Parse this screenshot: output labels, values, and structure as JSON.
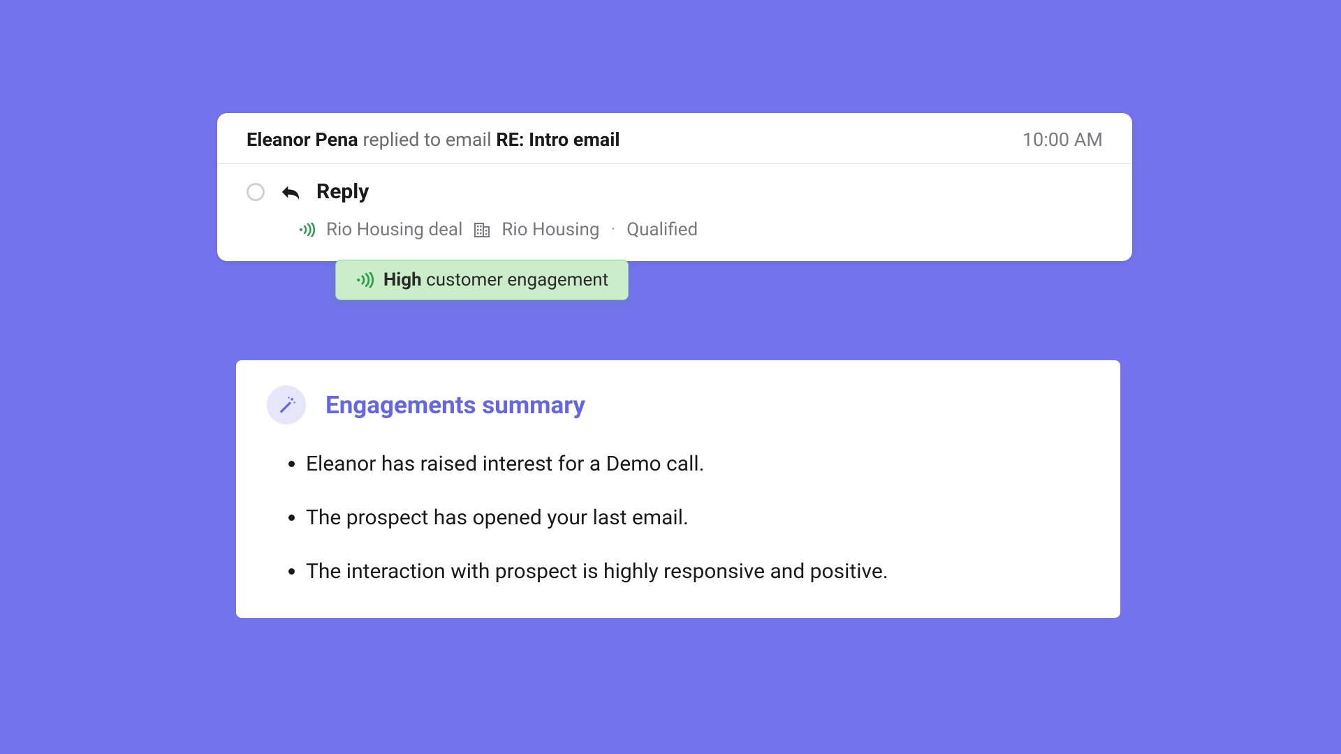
{
  "email": {
    "person": "Eleanor Pena",
    "action": "replied to email",
    "subject": "RE: Intro email",
    "time": "10:00 AM"
  },
  "reply": {
    "label": "Reply"
  },
  "meta": {
    "deal": "Rio Housing deal",
    "company": "Rio Housing",
    "status": "Qualified"
  },
  "engagement": {
    "bold": "High",
    "rest": "customer engagement"
  },
  "summary": {
    "title": "Engagements summary",
    "items": [
      "Eleanor has raised interest for a Demo call.",
      "The prospect has opened your last email.",
      "The interaction with prospect is highly responsive and positive."
    ]
  },
  "colors": {
    "background": "#7474ed",
    "accent": "#6565e8",
    "badge_bg": "#ccedc9",
    "green": "#2a9d4a"
  }
}
